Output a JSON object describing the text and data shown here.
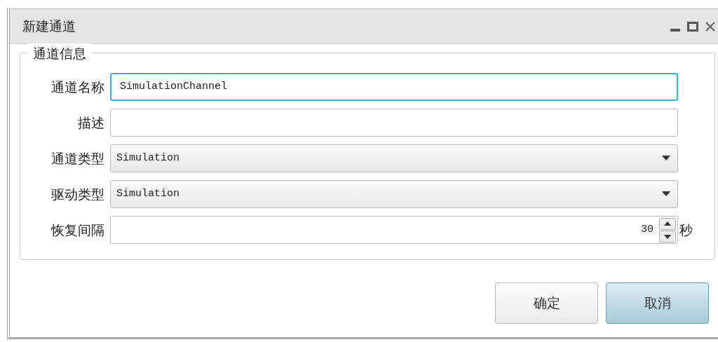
{
  "window": {
    "title": "新建通道"
  },
  "group": {
    "title": "通道信息"
  },
  "fields": [
    {
      "kind": "text",
      "label": "通道名称",
      "value": "SimulationChannel",
      "focused": true
    },
    {
      "kind": "text",
      "label": "描述",
      "focused": false
    },
    {
      "kind": "dropdown",
      "label": "通道类型",
      "value": "Simulation",
      "focused": false
    },
    {
      "kind": "dropdown",
      "label": "驱动类型",
      "value": "Simulation",
      "focused": false
    },
    {
      "kind": "spinner",
      "label": "恢复间隔",
      "value": "30",
      "unit": "秒",
      "focused": false
    }
  ],
  "buttons": [
    {
      "label": "确定",
      "highlighted": false
    },
    {
      "label": "取消",
      "highlighted": true
    }
  ]
}
